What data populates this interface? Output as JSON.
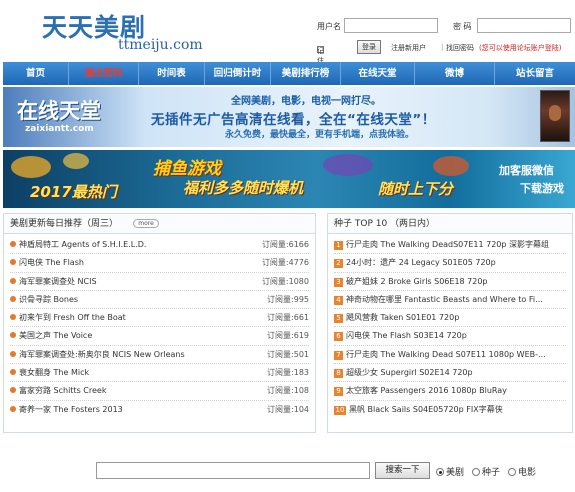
{
  "header": {
    "logo_cn_1": "天天",
    "logo_cn_2": "美剧",
    "logo_en": "ttmeiju.com"
  },
  "login": {
    "username_label": "用户名",
    "username_value": "",
    "password_label": "密  码",
    "password_value": "",
    "remember_label": "记住我",
    "login_button": "登录",
    "register_link": "注册新用户",
    "recover_link": "找回密码",
    "forum_note": "(您可以使用论坛账户登陆)"
  },
  "nav": {
    "items": [
      {
        "label": "首页",
        "active": false
      },
      {
        "label": "播出密码",
        "active": true
      },
      {
        "label": "时间表",
        "active": false
      },
      {
        "label": "回归倒计时",
        "active": false
      },
      {
        "label": "美剧排行榜",
        "active": false
      },
      {
        "label": "在线天堂",
        "active": false
      },
      {
        "label": "微博",
        "active": false
      },
      {
        "label": "站长留言",
        "active": false
      }
    ]
  },
  "banner1": {
    "logo": "在线天堂",
    "logo_sub": "zaixiantt.com",
    "line1": "全网美剧，电影，电视一网打尽。",
    "line2": "无插件无广告高清在线看，全在“在线天堂”！",
    "line3": "永久免费，最快最全，更有手机端，点我体验。"
  },
  "banner2": {
    "line1": "捕鱼游戏",
    "line2": "2017最热门",
    "line3": "福利多多随时爆机",
    "line4": "随时上下分",
    "cta1": "加客服微信",
    "cta2": "下载游戏"
  },
  "left_panel": {
    "title": "美剧更新每日推荐（周三）",
    "more": "more",
    "items": [
      {
        "title": "神盾局特工 Agents of S.H.I.E.L.D.",
        "subs": "订阅量:6166"
      },
      {
        "title": "闪电侠 The Flash",
        "subs": "订阅量:4776"
      },
      {
        "title": "海军罪案调查处 NCIS",
        "subs": "订阅量:1080"
      },
      {
        "title": "识骨寻踪 Bones",
        "subs": "订阅量:995"
      },
      {
        "title": "初来乍到 Fresh Off the Boat",
        "subs": "订阅量:661"
      },
      {
        "title": "美国之声 The Voice",
        "subs": "订阅量:619"
      },
      {
        "title": "海军罪案调查处:新奥尔良 NCIS New Orleans",
        "subs": "订阅量:501"
      },
      {
        "title": "衰女翻身 The Mick",
        "subs": "订阅量:183"
      },
      {
        "title": "富家穷路 Schitts Creek",
        "subs": "订阅量:108"
      },
      {
        "title": "寄养一家 The Fosters 2013",
        "subs": "订阅量:104"
      }
    ]
  },
  "right_panel": {
    "title": "种子 TOP 10 （两日内）",
    "items": [
      {
        "num": "1",
        "title": "行尸走肉 The Walking DeadS07E11 720p 深影字幕组"
      },
      {
        "num": "2",
        "title": "24小时：遗产 24 Legacy S01E05 720p"
      },
      {
        "num": "3",
        "title": "破产姐妹 2 Broke Girls S06E18 720p"
      },
      {
        "num": "4",
        "title": "神奇动物在哪里 Fantastic Beasts and Where to Fi..."
      },
      {
        "num": "5",
        "title": "飓风营救 Taken S01E01 720p"
      },
      {
        "num": "6",
        "title": "闪电侠 The Flash S03E14 720p"
      },
      {
        "num": "7",
        "title": "行尸走肉 The Walking Dead S07E11 1080p WEB-..."
      },
      {
        "num": "8",
        "title": "超级少女 Supergirl S02E14 720p"
      },
      {
        "num": "9",
        "title": "太空旅客 Passengers 2016 1080p BluRay"
      },
      {
        "num": "10",
        "title": "黑帆 Black Sails S04E05720p FIX字幕侠"
      }
    ]
  },
  "search": {
    "value": "",
    "button": "搜索一下",
    "options": [
      {
        "label": "美剧",
        "checked": true
      },
      {
        "label": "种子",
        "checked": false
      },
      {
        "label": "电影",
        "checked": false
      }
    ]
  }
}
